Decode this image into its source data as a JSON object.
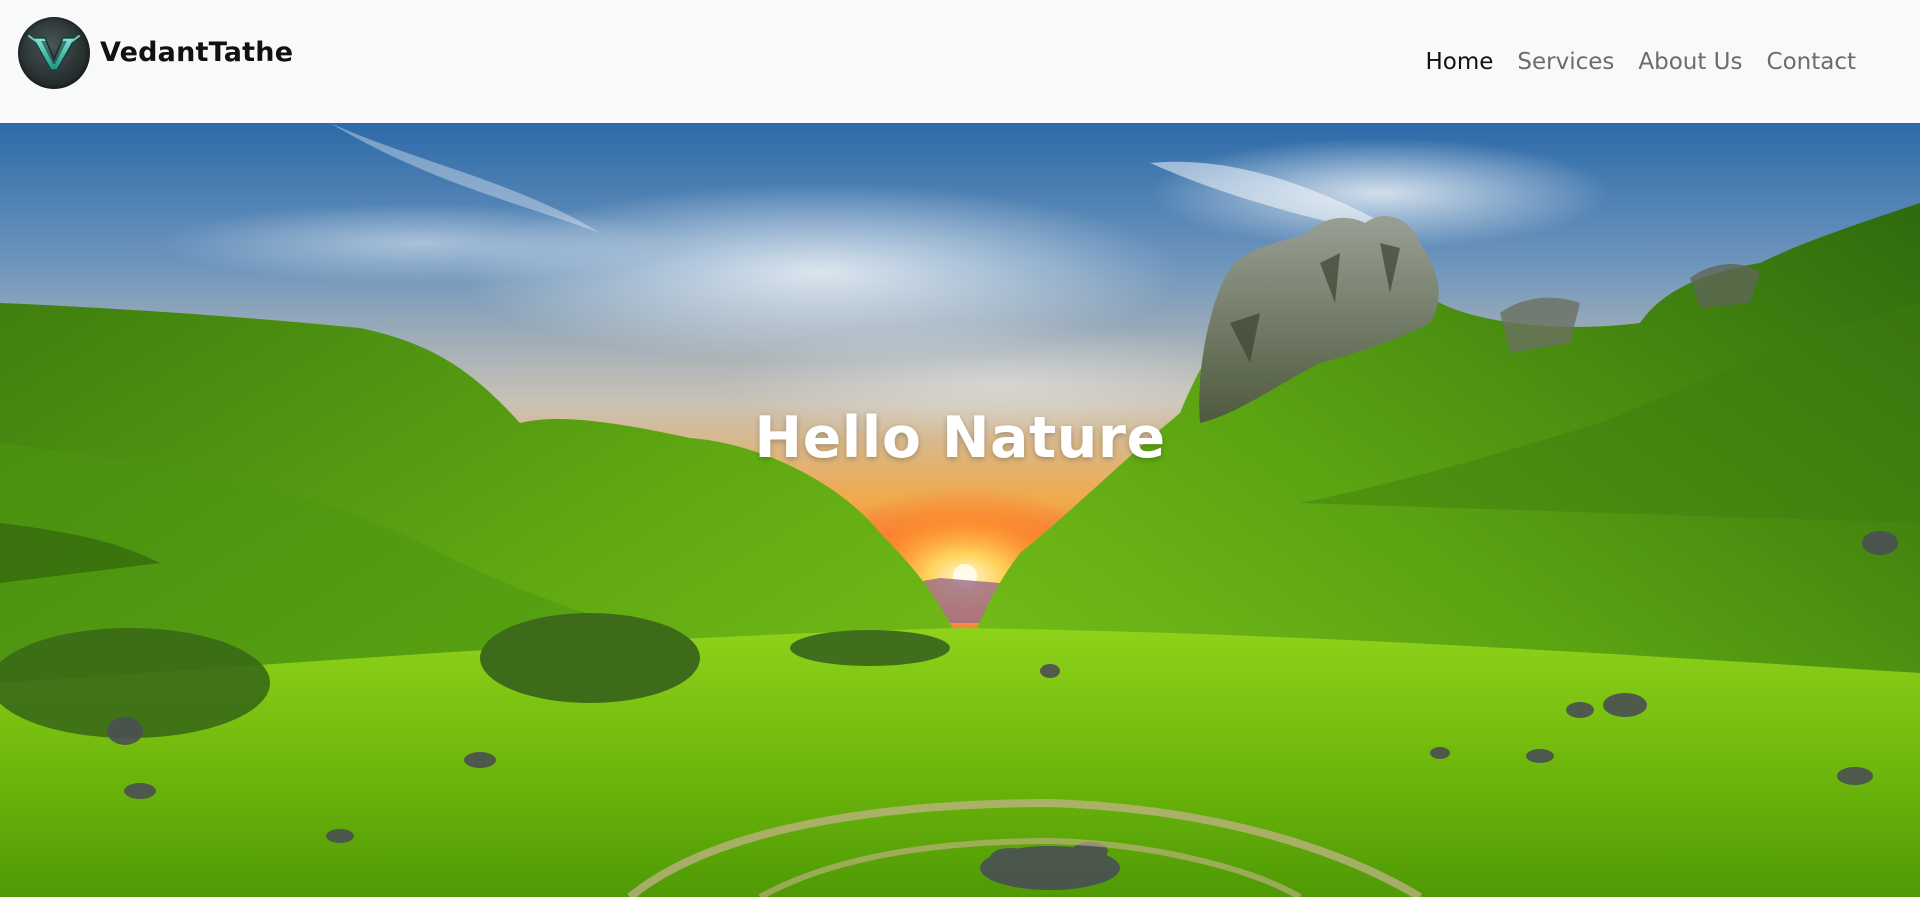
{
  "brand": {
    "name": "VedantTathe",
    "logo_icon": "v-emblem-icon"
  },
  "nav": {
    "items": [
      {
        "label": "Home",
        "active": true
      },
      {
        "label": "Services",
        "active": false
      },
      {
        "label": "About Us",
        "active": false
      },
      {
        "label": "Contact",
        "active": false
      }
    ]
  },
  "hero": {
    "title": "Hello Nature"
  },
  "colors": {
    "navbar_bg": "#f8f9fa",
    "nav_active": "#111111",
    "nav_inactive": "#6c6c6c",
    "hero_title": "#ffffff"
  }
}
